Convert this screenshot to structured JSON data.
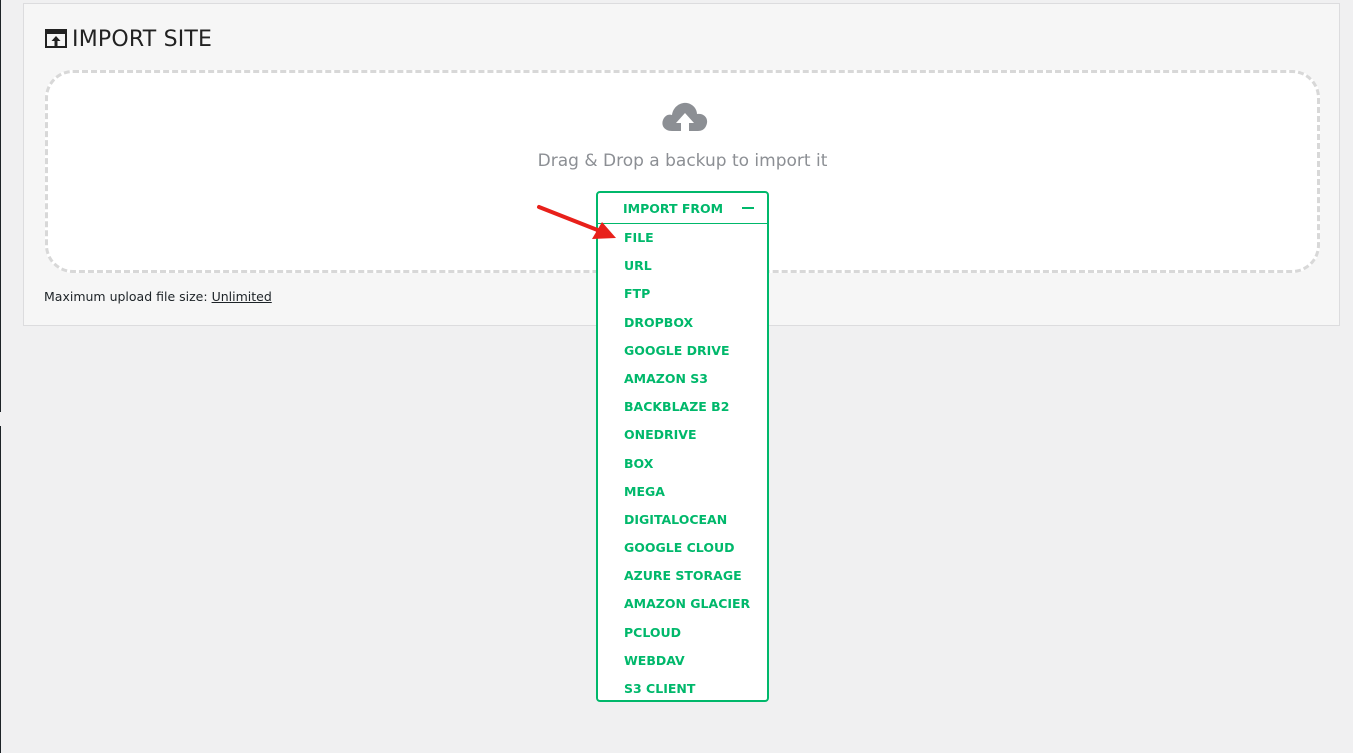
{
  "page": {
    "title": "IMPORT SITE",
    "title_icon": "import-site-icon"
  },
  "dropzone": {
    "icon": "cloud-upload-icon",
    "text": "Drag & Drop a backup to import it"
  },
  "upload_limit": {
    "label": "Maximum upload file size:",
    "value": "Unlimited"
  },
  "import_menu": {
    "header_label": "IMPORT FROM",
    "header_icon": "minus-icon",
    "options": [
      "FILE",
      "URL",
      "FTP",
      "DROPBOX",
      "GOOGLE DRIVE",
      "AMAZON S3",
      "BACKBLAZE B2",
      "ONEDRIVE",
      "BOX",
      "MEGA",
      "DIGITALOCEAN",
      "GOOGLE CLOUD",
      "AZURE STORAGE",
      "AMAZON GLACIER",
      "PCLOUD",
      "WEBDAV",
      "S3 CLIENT"
    ]
  },
  "annotation": {
    "icon": "red-arrow-icon",
    "color": "#e8201a"
  },
  "colors": {
    "accent": "#00b86b",
    "panel_bg": "#f6f6f6",
    "page_bg": "#f0f0f1",
    "muted_text": "#8c8f94"
  }
}
